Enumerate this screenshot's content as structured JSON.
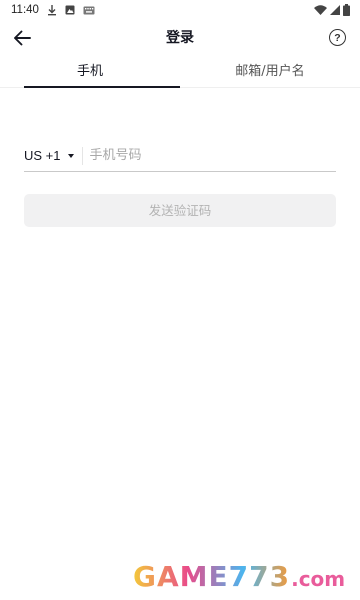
{
  "status_bar": {
    "time": "11:40",
    "left_icons": [
      "download-icon",
      "photo-icon",
      "keyboard-icon"
    ],
    "right_icons": [
      "wifi-icon",
      "signal-icon",
      "battery-icon"
    ]
  },
  "header": {
    "title": "登录",
    "back_icon": "arrow-left-icon",
    "help_label": "?"
  },
  "tabs": [
    {
      "label": "手机",
      "active": true
    },
    {
      "label": "邮箱/用户名",
      "active": false
    }
  ],
  "phone_form": {
    "country_code": "US +1",
    "placeholder": "手机号码",
    "value": ""
  },
  "send_code_button": {
    "label": "发送验证码",
    "enabled": false
  },
  "watermark": {
    "main": "GAME773",
    "domain": ".com"
  },
  "colors": {
    "text_primary": "#161823",
    "placeholder": "#a8a8a8",
    "button_disabled_bg": "#f1f1f2",
    "button_disabled_text": "#b3b3b3"
  }
}
